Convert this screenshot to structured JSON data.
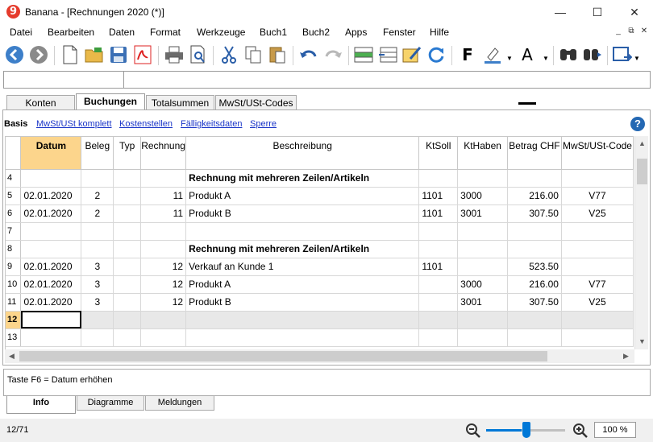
{
  "window": {
    "app_icon_glyph": "9",
    "title": "Banana - [Rechnungen 2020 (*)]",
    "minimize_glyph": "—",
    "maximize_glyph": "☐",
    "close_glyph": "✕"
  },
  "menu": [
    "Datei",
    "Bearbeiten",
    "Daten",
    "Format",
    "Werkzeuge",
    "Buch1",
    "Buch2",
    "Apps",
    "Fenster",
    "Hilfe"
  ],
  "mdi": {
    "minimize": "_",
    "restore": "⧉",
    "close": "✕"
  },
  "toolbar": {
    "bold_label": "F",
    "font_color_label": "A"
  },
  "tabs": [
    "Konten",
    "Buchungen",
    "Totalsummen",
    "MwSt/USt-Codes"
  ],
  "active_tab": "Buchungen",
  "views": {
    "active": "Basis",
    "links": [
      "MwSt/USt komplett",
      "Kostenstellen",
      "Fälligkeitsdaten",
      "Sperre"
    ]
  },
  "help_glyph": "?",
  "table": {
    "columns": [
      "Datum",
      "Beleg",
      "Typ",
      "Rechnung",
      "Beschreibung",
      "KtSoll",
      "KtHaben",
      "Betrag CHF",
      "MwSt/USt-Code"
    ],
    "rows": [
      {
        "n": "4",
        "datum": "",
        "beleg": "",
        "typ": "",
        "rechnung": "",
        "beschreibung": "Rechnung mit mehreren Zeilen/Artikeln",
        "ktsoll": "",
        "kthaben": "",
        "betrag": "",
        "mwst": "",
        "bold": true
      },
      {
        "n": "5",
        "datum": "02.01.2020",
        "beleg": "2",
        "typ": "",
        "rechnung": "11",
        "beschreibung": "Produkt A",
        "ktsoll": "1101",
        "kthaben": "3000",
        "betrag": "216.00",
        "mwst": "V77"
      },
      {
        "n": "6",
        "datum": "02.01.2020",
        "beleg": "2",
        "typ": "",
        "rechnung": "11",
        "beschreibung": "Produkt B",
        "ktsoll": "1101",
        "kthaben": "3001",
        "betrag": "307.50",
        "mwst": "V25"
      },
      {
        "n": "7",
        "datum": "",
        "beleg": "",
        "typ": "",
        "rechnung": "",
        "beschreibung": "",
        "ktsoll": "",
        "kthaben": "",
        "betrag": "",
        "mwst": ""
      },
      {
        "n": "8",
        "datum": "",
        "beleg": "",
        "typ": "",
        "rechnung": "",
        "beschreibung": "Rechnung mit mehreren Zeilen/Artikeln",
        "ktsoll": "",
        "kthaben": "",
        "betrag": "",
        "mwst": "",
        "bold": true
      },
      {
        "n": "9",
        "datum": "02.01.2020",
        "beleg": "3",
        "typ": "",
        "rechnung": "12",
        "beschreibung": "Verkauf an Kunde 1",
        "ktsoll": "1101",
        "kthaben": "",
        "betrag": "523.50",
        "mwst": ""
      },
      {
        "n": "10",
        "datum": "02.01.2020",
        "beleg": "3",
        "typ": "",
        "rechnung": "12",
        "beschreibung": "Produkt A",
        "ktsoll": "",
        "kthaben": "3000",
        "betrag": "216.00",
        "mwst": "V77"
      },
      {
        "n": "11",
        "datum": "02.01.2020",
        "beleg": "3",
        "typ": "",
        "rechnung": "12",
        "beschreibung": "Produkt B",
        "ktsoll": "",
        "kthaben": "3001",
        "betrag": "307.50",
        "mwst": "V25"
      },
      {
        "n": "12",
        "datum": "",
        "beleg": "",
        "typ": "",
        "rechnung": "",
        "beschreibung": "",
        "ktsoll": "",
        "kthaben": "",
        "betrag": "",
        "mwst": "",
        "selected": true
      },
      {
        "n": "13",
        "datum": "",
        "beleg": "",
        "typ": "",
        "rechnung": "",
        "beschreibung": "",
        "ktsoll": "",
        "kthaben": "",
        "betrag": "",
        "mwst": ""
      }
    ]
  },
  "scroll": {
    "up": "▲",
    "down": "▼",
    "left": "◀",
    "right": "▶"
  },
  "info": {
    "text": "Taste F6 = Datum erhöhen"
  },
  "bottom_tabs": [
    "Info",
    "Diagramme",
    "Meldungen"
  ],
  "status": {
    "count": "12/71",
    "zoom": "100 %",
    "zoom_level": 0.45
  },
  "colors": {
    "selection": "#fcd58c",
    "link": "#1a35c8",
    "accent": "#0078d7"
  }
}
